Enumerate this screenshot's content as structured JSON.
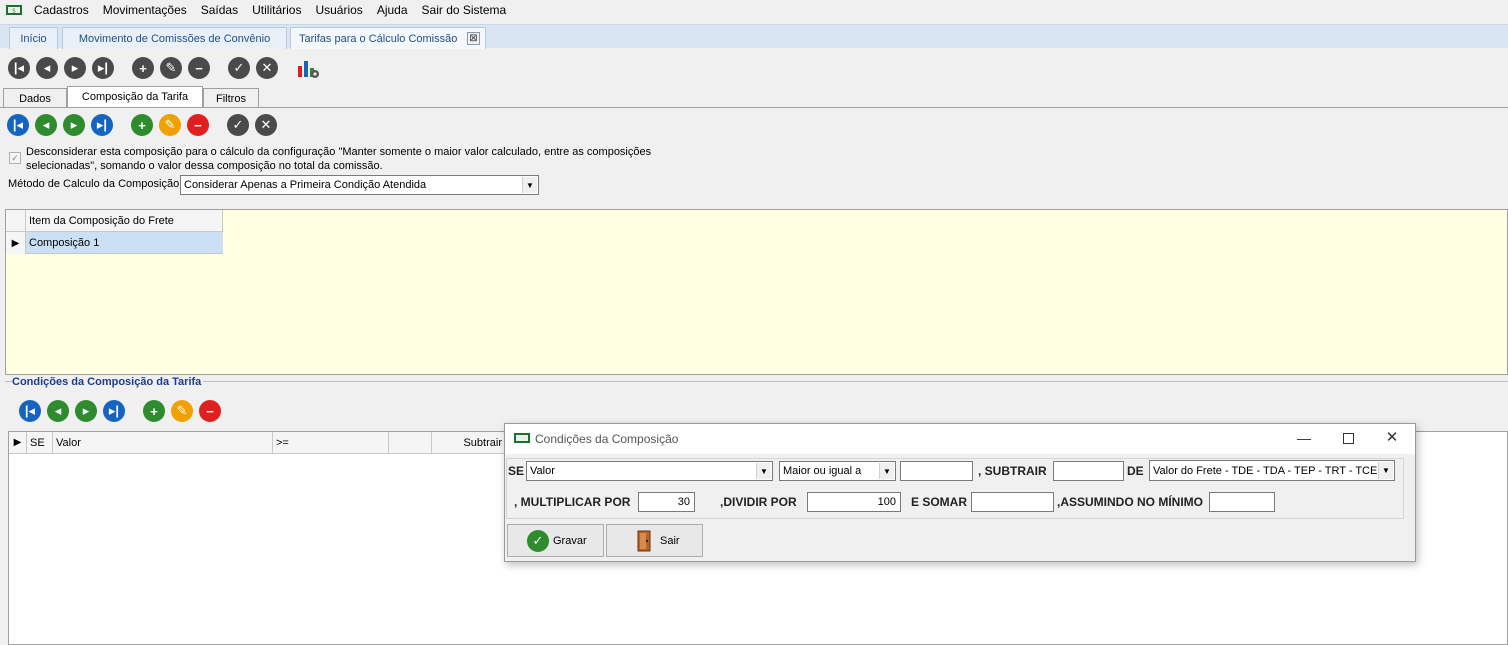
{
  "menu": [
    "Cadastros",
    "Movimentações",
    "Saídas",
    "Utilitários",
    "Usuários",
    "Ajuda",
    "Sair do Sistema"
  ],
  "tabs": [
    "Início",
    "Movimento de Comissões de Convênio",
    "Tarifas para o Cálculo Comissão"
  ],
  "tab_close": "⊠",
  "subtabs": [
    "Dados",
    "Composição da Tarifa",
    "Filtros"
  ],
  "form": {
    "checkbox_label_line1": "Desconsiderar esta composição para o cálculo da configuração \"Manter somente o maior valor calculado, entre as composições",
    "checkbox_label_line2": "selecionadas\", somando o valor dessa composição no total da comissão.",
    "method_label": "Método de Calculo da Composição",
    "method_value": "Considerar Apenas a Primeira Condição Atendida"
  },
  "grid1": {
    "header": "Item da Composição do Frete",
    "rows": [
      "Composição 1"
    ]
  },
  "conditions": {
    "title": "Condições da Composição da Tarifa",
    "columns": [
      "SE",
      "Valor",
      ">=",
      "Subtrair"
    ]
  },
  "dialog": {
    "title": "Condições da Composição",
    "se_label": "SE",
    "se_value": "Valor",
    "operator_value": "Maior ou igual a",
    "compare_value": "",
    "subtrair_label": ", SUBTRAIR",
    "subtrair_value": "",
    "de_label": "DE",
    "de_value": "Valor do Frete - TDE - TDA - TEP - TRT - TCE",
    "multiplicar_label": ", MULTIPLICAR POR",
    "multiplicar_value": "30",
    "dividir_label": ",DIVIDIR POR",
    "dividir_value": "100",
    "somar_label": "E SOMAR",
    "somar_value": "",
    "minimo_label": ",ASSUMINDO NO MÍNIMO",
    "minimo_value": "",
    "gravar": "Gravar",
    "sair": "Sair"
  },
  "colors": {
    "tabstrip": "#d9e5f2",
    "grid_bg": "#ffffe1",
    "selected_row": "#cce0f5",
    "nav_blue": "#1565c0",
    "add_green": "#2e8b2e",
    "edit_orange": "#f0a000",
    "delete_red": "#e02020"
  }
}
